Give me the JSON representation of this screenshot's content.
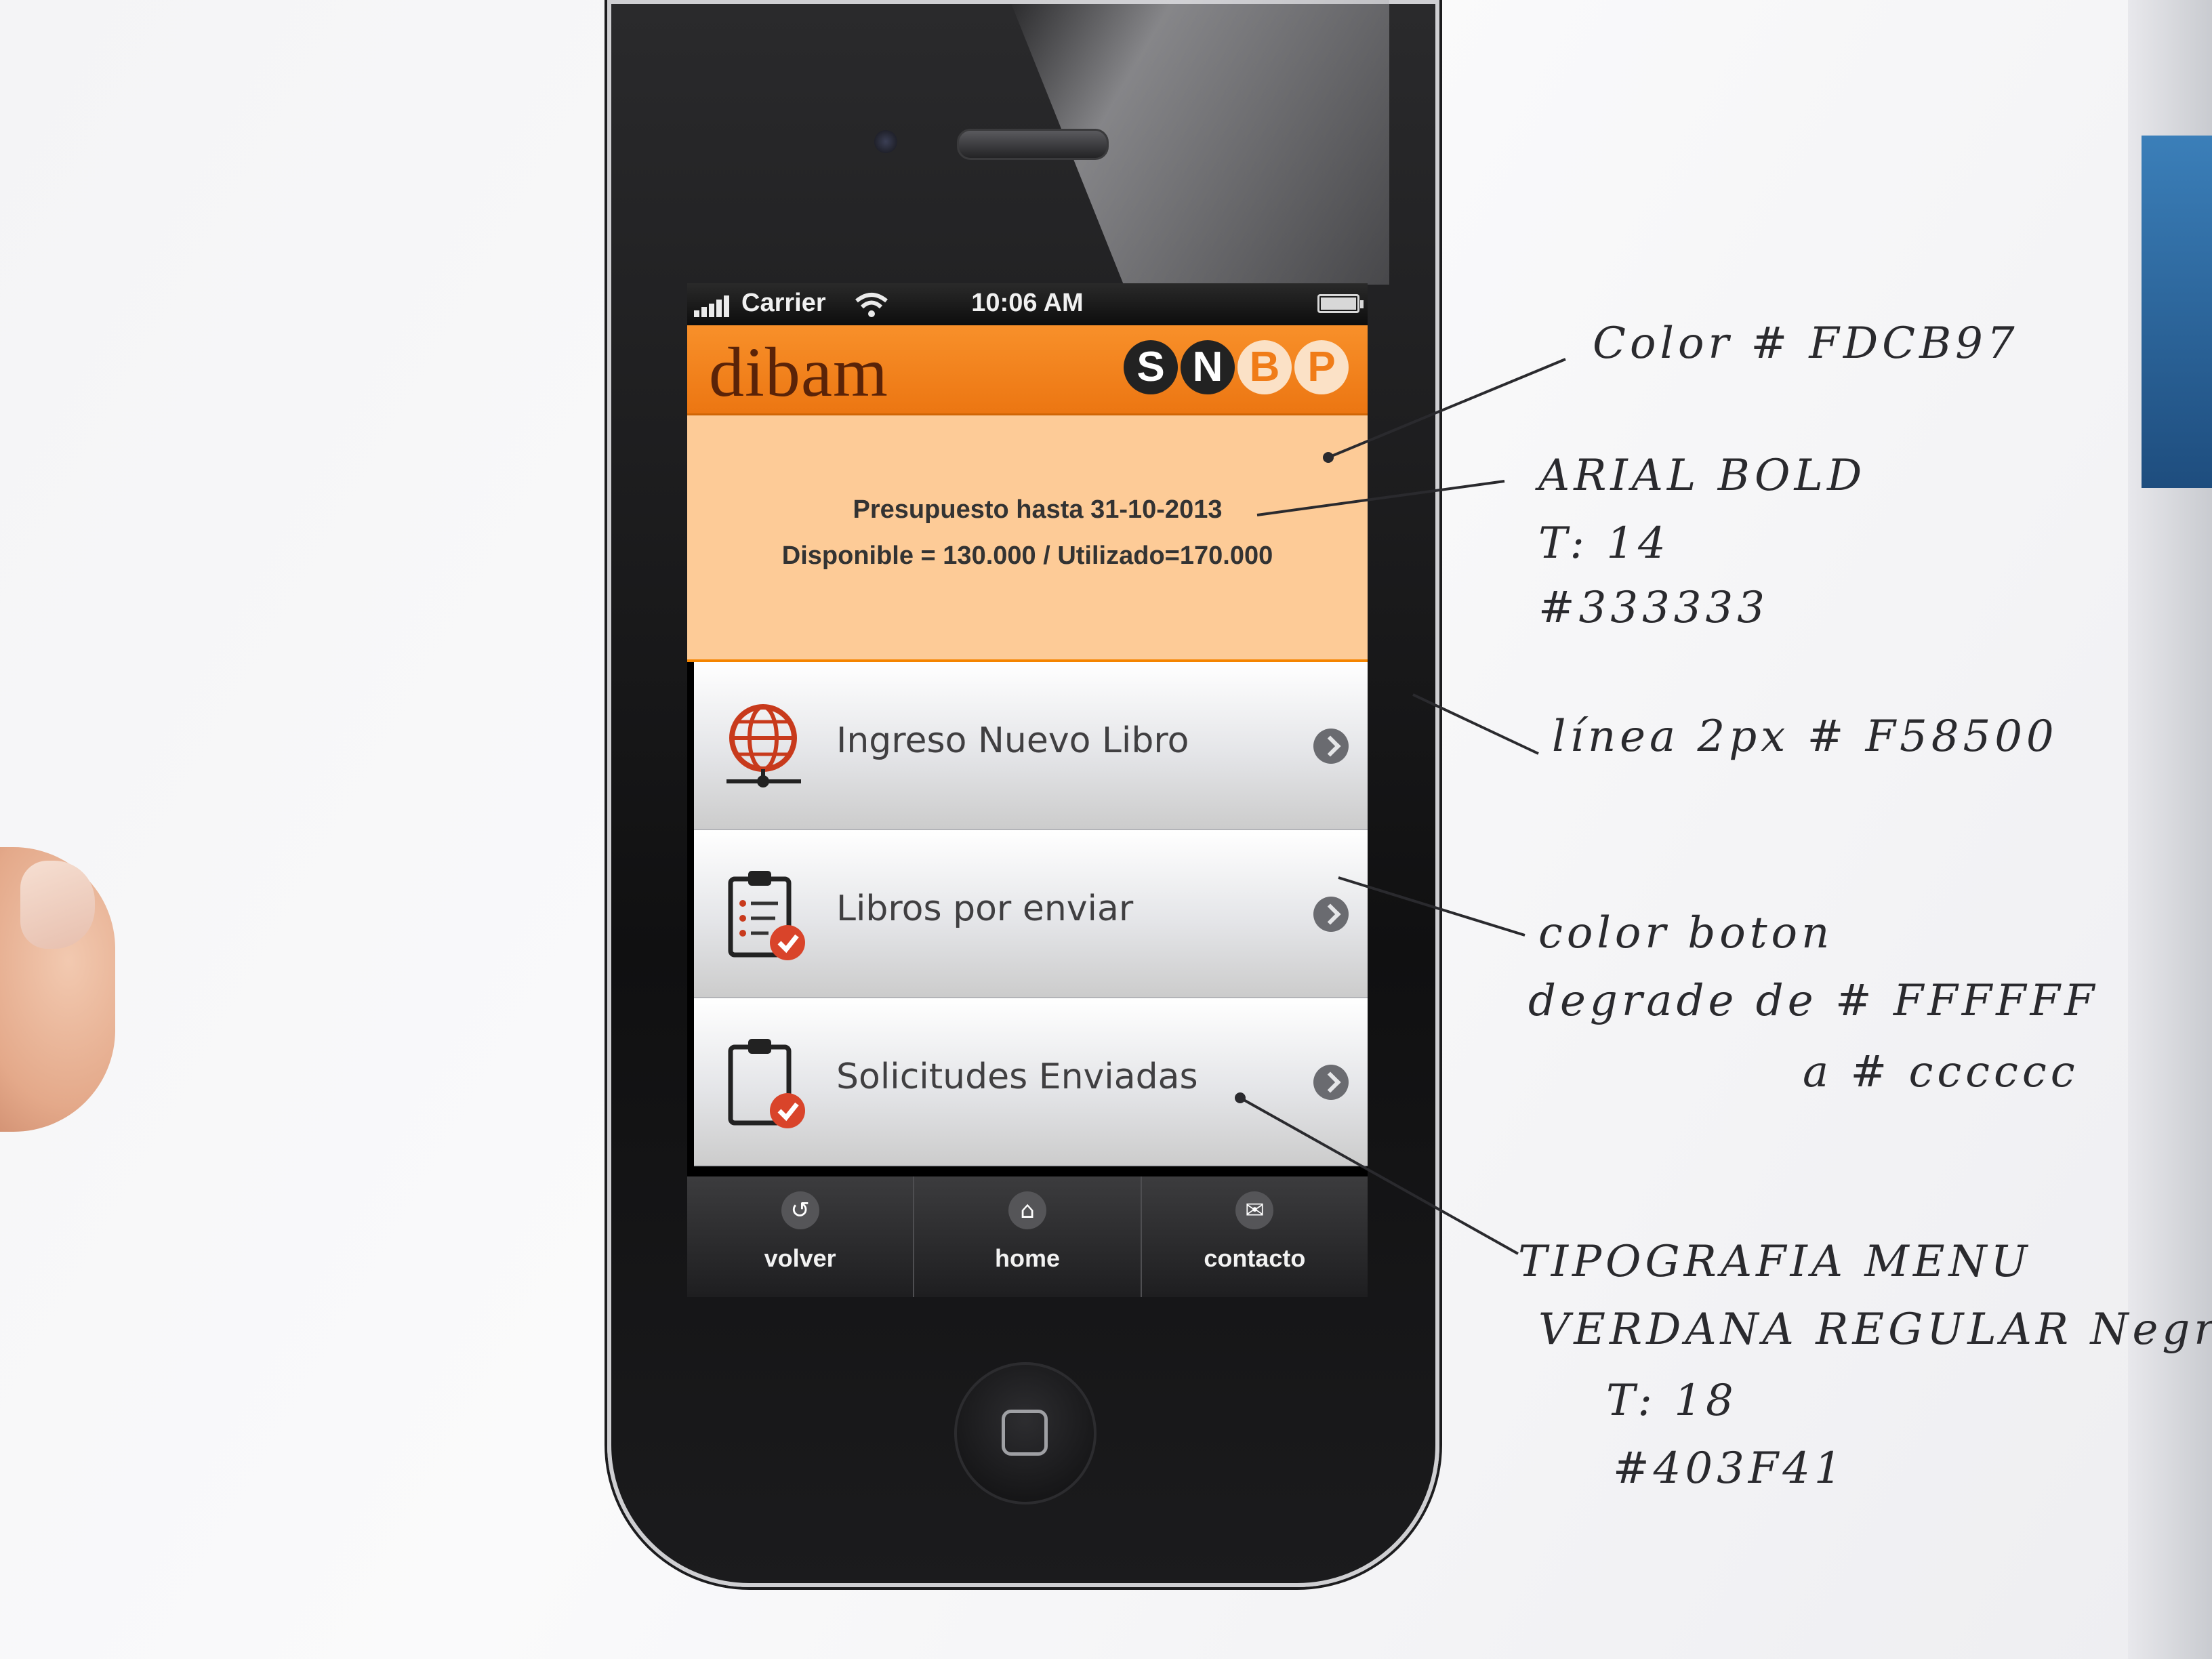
{
  "status_bar": {
    "carrier": "Carrier",
    "time": "10:06 AM"
  },
  "header": {
    "logo_text": "dibam",
    "badge_letters": [
      "S",
      "N",
      "B",
      "P"
    ]
  },
  "budget": {
    "line1": "Presupuesto hasta 31-10-2013",
    "line2": "Disponible = 130.000 / Utilizado=170.000"
  },
  "menu": {
    "items": [
      {
        "label": "Ingreso Nuevo Libro",
        "icon": "globe-book-icon"
      },
      {
        "label": "Libros por enviar",
        "icon": "clipboard-list-check-icon"
      },
      {
        "label": "Solicitudes Enviadas",
        "icon": "clipboard-check-icon"
      }
    ]
  },
  "tabbar": {
    "items": [
      {
        "label": "volver",
        "icon": "back-arrow-icon"
      },
      {
        "label": "home",
        "icon": "home-icon"
      },
      {
        "label": "contacto",
        "icon": "envelope-icon"
      }
    ]
  },
  "annotations": {
    "header_color": "Color # FDCB97",
    "font_name": "ARIAL BOLD",
    "font_size": "T: 14",
    "font_color": "#333333",
    "line": "línea 2px # F58500",
    "button_color_1": "color boton",
    "button_color_2": "degrade de # FFFFFF",
    "button_color_3": "a # cccccc",
    "menu_font_1": "TIPOGRAFIA MENU",
    "menu_font_2": "VERDANA REGULAR Negrita",
    "menu_font_3": "T: 18",
    "menu_font_4": "#403F41"
  },
  "colors": {
    "header_orange": "#f58500",
    "budget_panel": "#fdcb97",
    "budget_text": "#333333",
    "menu_text": "#403f41",
    "button_gradient_top": "#ffffff",
    "button_gradient_bottom": "#cccccc"
  }
}
